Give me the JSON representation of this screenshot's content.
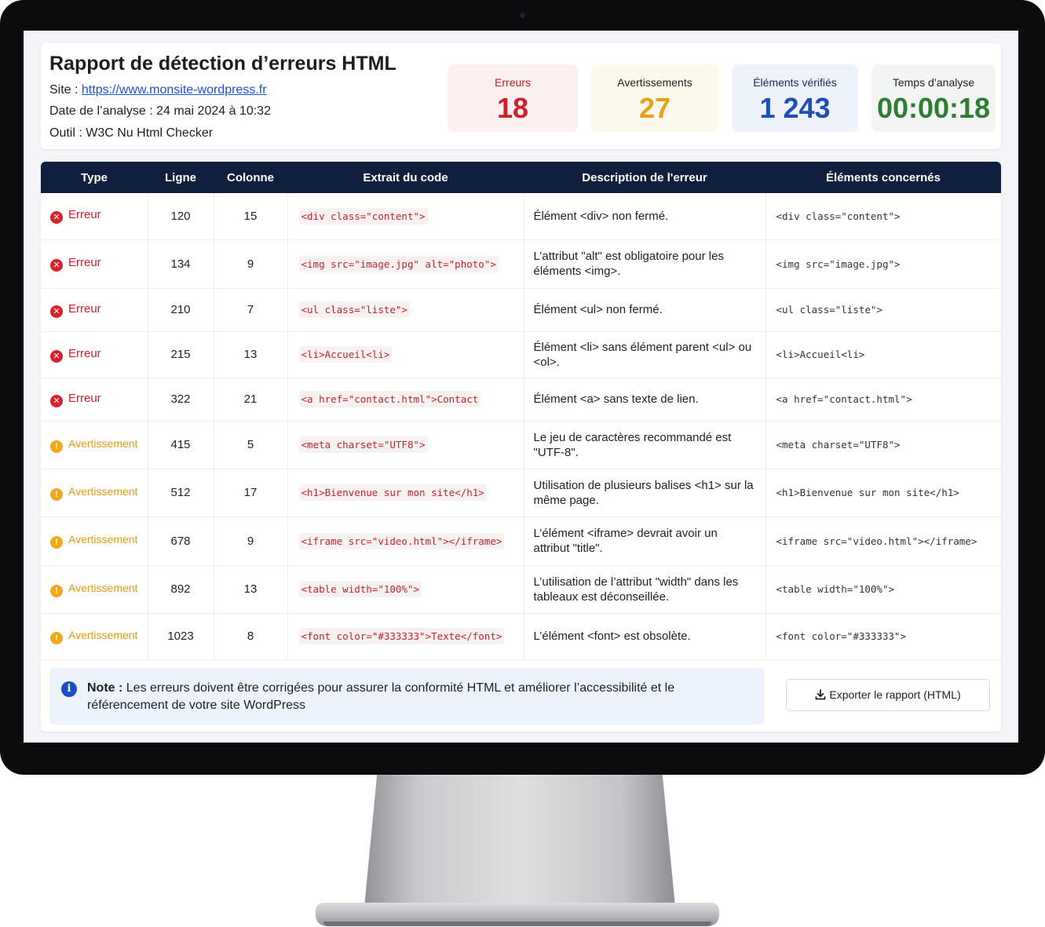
{
  "report": {
    "title": "Rapport de détection d’erreurs HTML",
    "site_label": "Site : ",
    "site_url": "https://www.monsite-wordpress.fr",
    "date_label": "Date de l’analyse : ",
    "date_value": "24 mai 2024 à 10:32",
    "tool_label": "Outil : ",
    "tool_value": "W3C Nu Html Checker"
  },
  "stats": {
    "errors": {
      "label": "Erreurs",
      "value": "18",
      "color": "#d0202b"
    },
    "warnings": {
      "label": "Avertissements",
      "value": "27",
      "color": "#e8a11a"
    },
    "checked": {
      "label": "Éléments vérifiés",
      "value": "1 243",
      "color": "#1e4fb8"
    },
    "time": {
      "label": "Temps d’analyse",
      "value": "00:00:18",
      "color": "#2f7d34"
    }
  },
  "table": {
    "headers": [
      "Type",
      "Ligne",
      "Colonne",
      "Extrait du code",
      "Description de l'erreur",
      "Éléments concernés"
    ],
    "rows": [
      {
        "type": "Erreur",
        "line": "120",
        "column": "15",
        "code": "<div class=\"content\">",
        "description": "Élément <div> non fermé.",
        "elements": "<div class=\"content\">"
      },
      {
        "type": "Erreur",
        "line": "134",
        "column": "9",
        "code": "<img src=\"image.jpg\" alt=\"photo\">",
        "description": "L’attribut \"alt\" est obligatoire pour les éléments <img>.",
        "elements": "<img src=\"image.jpg\">"
      },
      {
        "type": "Erreur",
        "line": "210",
        "column": "7",
        "code": "<ul class=\"liste\">",
        "description": "Élément <ul> non fermé.",
        "elements": "<ul class=\"liste\">"
      },
      {
        "type": "Erreur",
        "line": "215",
        "column": "13",
        "code": "<li>Accueil<li>",
        "description": "Élément <li> sans élément parent <ul> ou <ol>.",
        "elements": "<li>Accueil<li>"
      },
      {
        "type": "Erreur",
        "line": "322",
        "column": "21",
        "code": "<a href=\"contact.html\">Contact",
        "description": "Élément <a> sans texte de lien.",
        "elements": "<a href=\"contact.html\">"
      },
      {
        "type": "Avertissement",
        "line": "415",
        "column": "5",
        "code": "<meta charset=\"UTF8\">",
        "description": "Le jeu de caractères recommandé est \"UTF-8\".",
        "elements": "<meta charset=\"UTF8\">"
      },
      {
        "type": "Avertissement",
        "line": "512",
        "column": "17",
        "code": "<h1>Bienvenue sur mon site</h1>",
        "description": "Utilisation de plusieurs balises <h1> sur la même page.",
        "elements": "<h1>Bienvenue sur mon site</h1>"
      },
      {
        "type": "Avertissement",
        "line": "678",
        "column": "9",
        "code": "<iframe src=\"video.html\"></iframe>",
        "description": "L’élément <iframe> devrait avoir un attribut \"title\".",
        "elements": "<iframe src=\"video.html\"></iframe>"
      },
      {
        "type": "Avertissement",
        "line": "892",
        "column": "13",
        "code": "<table width=\"100%\">",
        "description": "L’utilisation de l’attribut \"width\" dans les tableaux est déconseillée.",
        "elements": "<table width=\"100%\">"
      },
      {
        "type": "Avertissement",
        "line": "1023",
        "column": "8",
        "code": "<font color=\"#333333\">Texte</font>",
        "description": "L’élément <font> est obsolète.",
        "elements": "<font color=\"#333333\">"
      }
    ]
  },
  "note": {
    "label": "Note :",
    "text": " Les erreurs doivent être corrigées pour assurer la conformité HTML et améliorer l’accessibilité et le référencement de votre site WordPress"
  },
  "export": {
    "label": "Exporter le rapport (HTML)",
    "icon": "download-icon"
  },
  "icons": {
    "error": "x-circle-icon",
    "warning": "exclamation-circle-icon",
    "info": "info-icon"
  }
}
